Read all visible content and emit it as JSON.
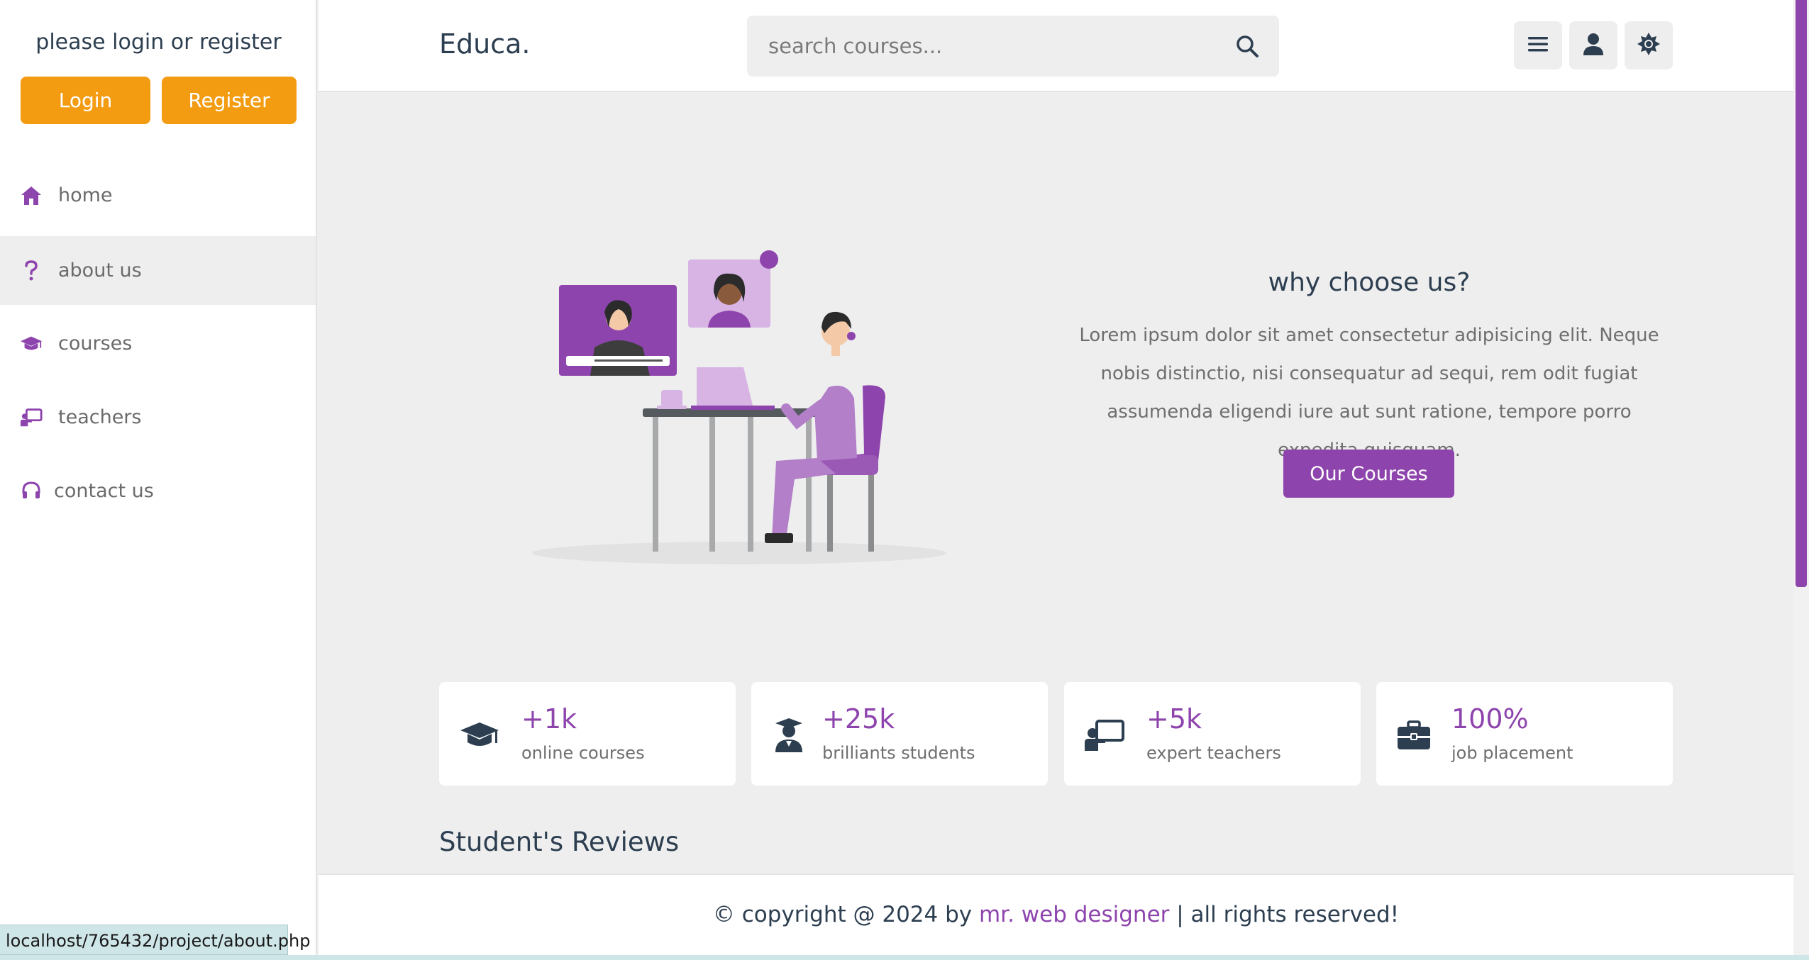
{
  "sidebar": {
    "login_prompt": "please login or register",
    "login_button": "Login",
    "register_button": "Register",
    "nav": [
      {
        "label": "home",
        "icon": "home-icon"
      },
      {
        "label": "about us",
        "icon": "question-icon",
        "active": true
      },
      {
        "label": "courses",
        "icon": "graduation-cap-icon"
      },
      {
        "label": "teachers",
        "icon": "chalkboard-teacher-icon"
      },
      {
        "label": "contact us",
        "icon": "headset-icon"
      }
    ]
  },
  "header": {
    "logo": "Educa.",
    "search_placeholder": "search courses...",
    "menu_icon": "bars-icon",
    "user_icon": "user-icon",
    "theme_icon": "sun-icon"
  },
  "hero": {
    "title": "why choose us?",
    "text": "Lorem ipsum dolor sit amet consectetur adipisicing elit. Neque nobis distinctio, nisi consequatur ad sequi, rem odit fugiat assumenda eligendi iure aut sunt ratione, tempore porro expedita quisquam.",
    "button": "Our Courses"
  },
  "stats": [
    {
      "value": "+1k",
      "label": "online courses",
      "icon": "graduation-cap-icon"
    },
    {
      "value": "+25k",
      "label": "brilliants students",
      "icon": "user-graduate-icon"
    },
    {
      "value": "+5k",
      "label": "expert teachers",
      "icon": "chalkboard-teacher-icon"
    },
    {
      "value": "100%",
      "label": "job placement",
      "icon": "briefcase-icon"
    }
  ],
  "reviews_title": "Student's Reviews",
  "footer": {
    "prefix": "© copyright @ 2024 by ",
    "link": "mr. web designer",
    "suffix": " | all rights reserved!"
  },
  "statusbar": "localhost/765432/project/about.php",
  "colors": {
    "accent": "#8e44ad",
    "orange": "#f39c12",
    "dark": "#2c3e50",
    "background": "#eeeeee"
  }
}
